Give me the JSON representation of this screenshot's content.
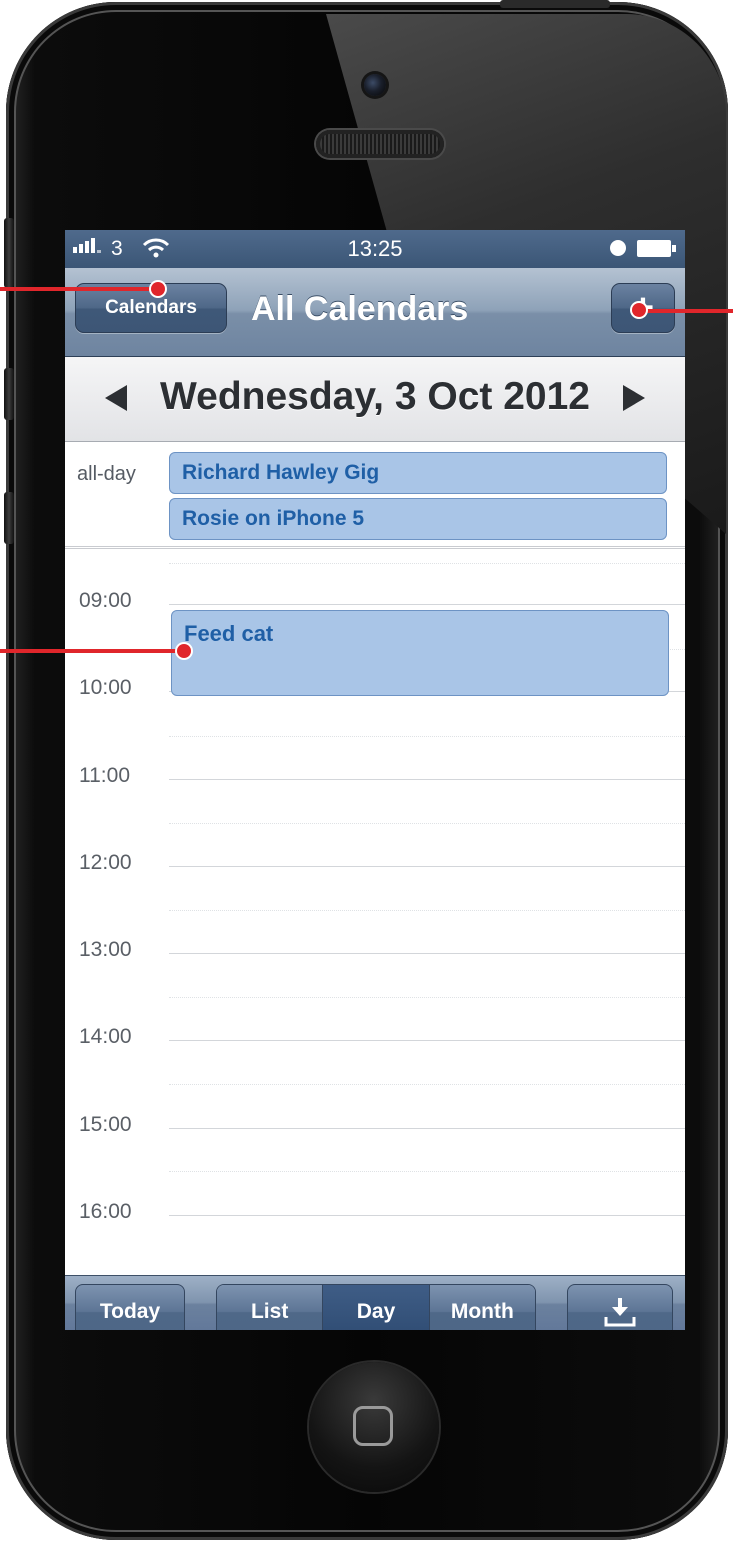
{
  "status_bar": {
    "carrier": "3",
    "time": "13:25"
  },
  "nav_bar": {
    "calendars_button": "Calendars",
    "title": "All Calendars",
    "add_button": "+"
  },
  "date_bar": {
    "date": "Wednesday, 3 Oct 2012"
  },
  "all_day": {
    "label": "all-day",
    "events": [
      "Richard Hawley Gig",
      "Rosie on iPhone 5"
    ]
  },
  "timeline": {
    "hours": [
      "09:00",
      "10:00",
      "11:00",
      "12:00",
      "13:00",
      "14:00",
      "15:00",
      "16:00"
    ],
    "events": [
      {
        "title": "Feed cat"
      }
    ]
  },
  "toolbar": {
    "today_button": "Today",
    "views": [
      "List",
      "Day",
      "Month"
    ],
    "selected_view": "Day"
  },
  "colors": {
    "accent": "#3b5676",
    "event_fill": "#a9c5e7",
    "event_text": "#1f5fa6",
    "callout": "#e0262b"
  },
  "icons": {
    "signal": "signal-bars-icon",
    "wifi": "wifi-icon",
    "alarm": "alarm-clock-icon",
    "battery": "battery-icon",
    "prev": "left-triangle-icon",
    "next": "right-triangle-icon",
    "inbox": "download-tray-icon"
  }
}
